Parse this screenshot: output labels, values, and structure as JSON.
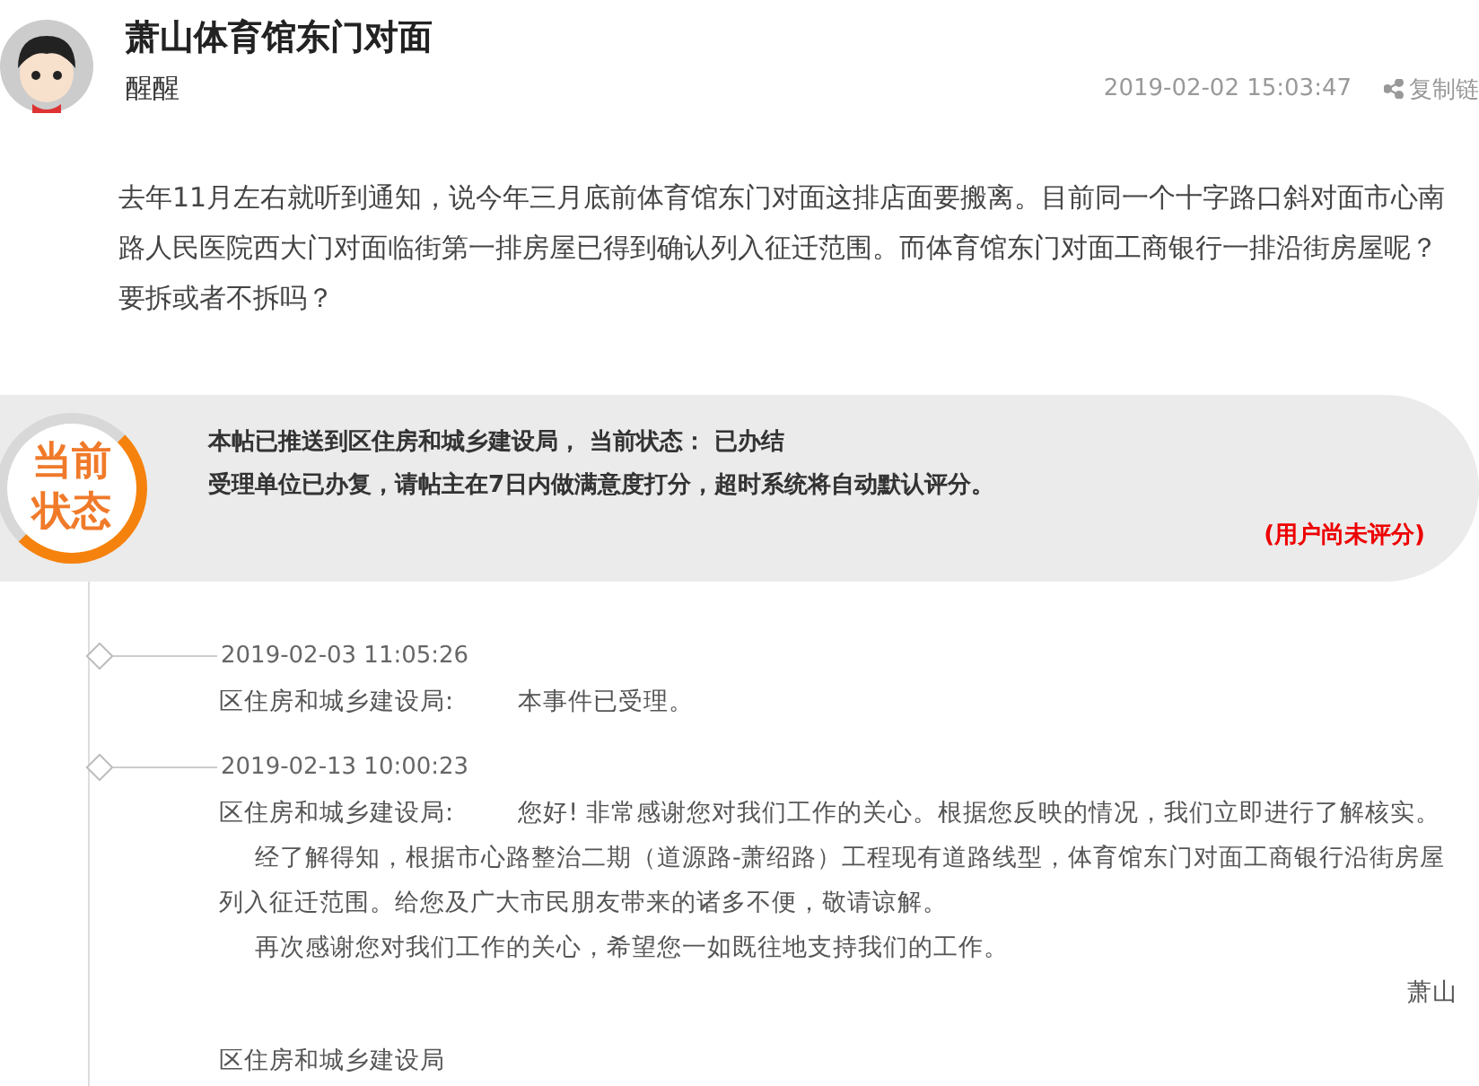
{
  "post": {
    "title": "萧山体育馆东门对面",
    "author": "醒醒",
    "time": "2019-02-02 15:03:47",
    "share_link": "复制链",
    "body": "去年11月左右就听到通知，说今年三月底前体育馆东门对面这排店面要搬离。目前同一个十字路口斜对面市心南路人民医院西大门对面临街第一排房屋已得到确认列入征迁范围。而体育馆东门对面工商银行一排沿街房屋呢？要拆或者不拆吗？"
  },
  "status": {
    "badge_lines": [
      "当前",
      "状态"
    ],
    "line_1": "本帖已推送到区住房和城乡建设局， 当前状态： 已办结",
    "line_2": "受理单位已办复，请帖主在7日内做满意度打分，超时系统将自动默认评分。",
    "rating": "(用户尚未评分)"
  },
  "timeline": [
    {
      "time": "2019-02-03 11:05:26",
      "author": "区住房和城乡建设局:",
      "paragraphs": [
        "本事件已受理。"
      ]
    },
    {
      "time": "2019-02-13 10:00:23",
      "author": "区住房和城乡建设局:",
      "paragraphs": [
        "您好! 非常感谢您对我们工作的关心。根据您反映的情况，我们立即进行了解核实。",
        "经了解得知，根据市心路整治二期（道源路-萧绍路）工程现有道路线型，体育馆东门对面工商银行沿街房屋列入征迁范围。给您及广大市民朋友带来的诸多不便，敬请谅解。",
        "再次感谢您对我们工作的关心，希望您一如既往地支持我们的工作。"
      ],
      "signature": "萧山"
    }
  ],
  "trailing_text": "区住房和城乡建设局"
}
